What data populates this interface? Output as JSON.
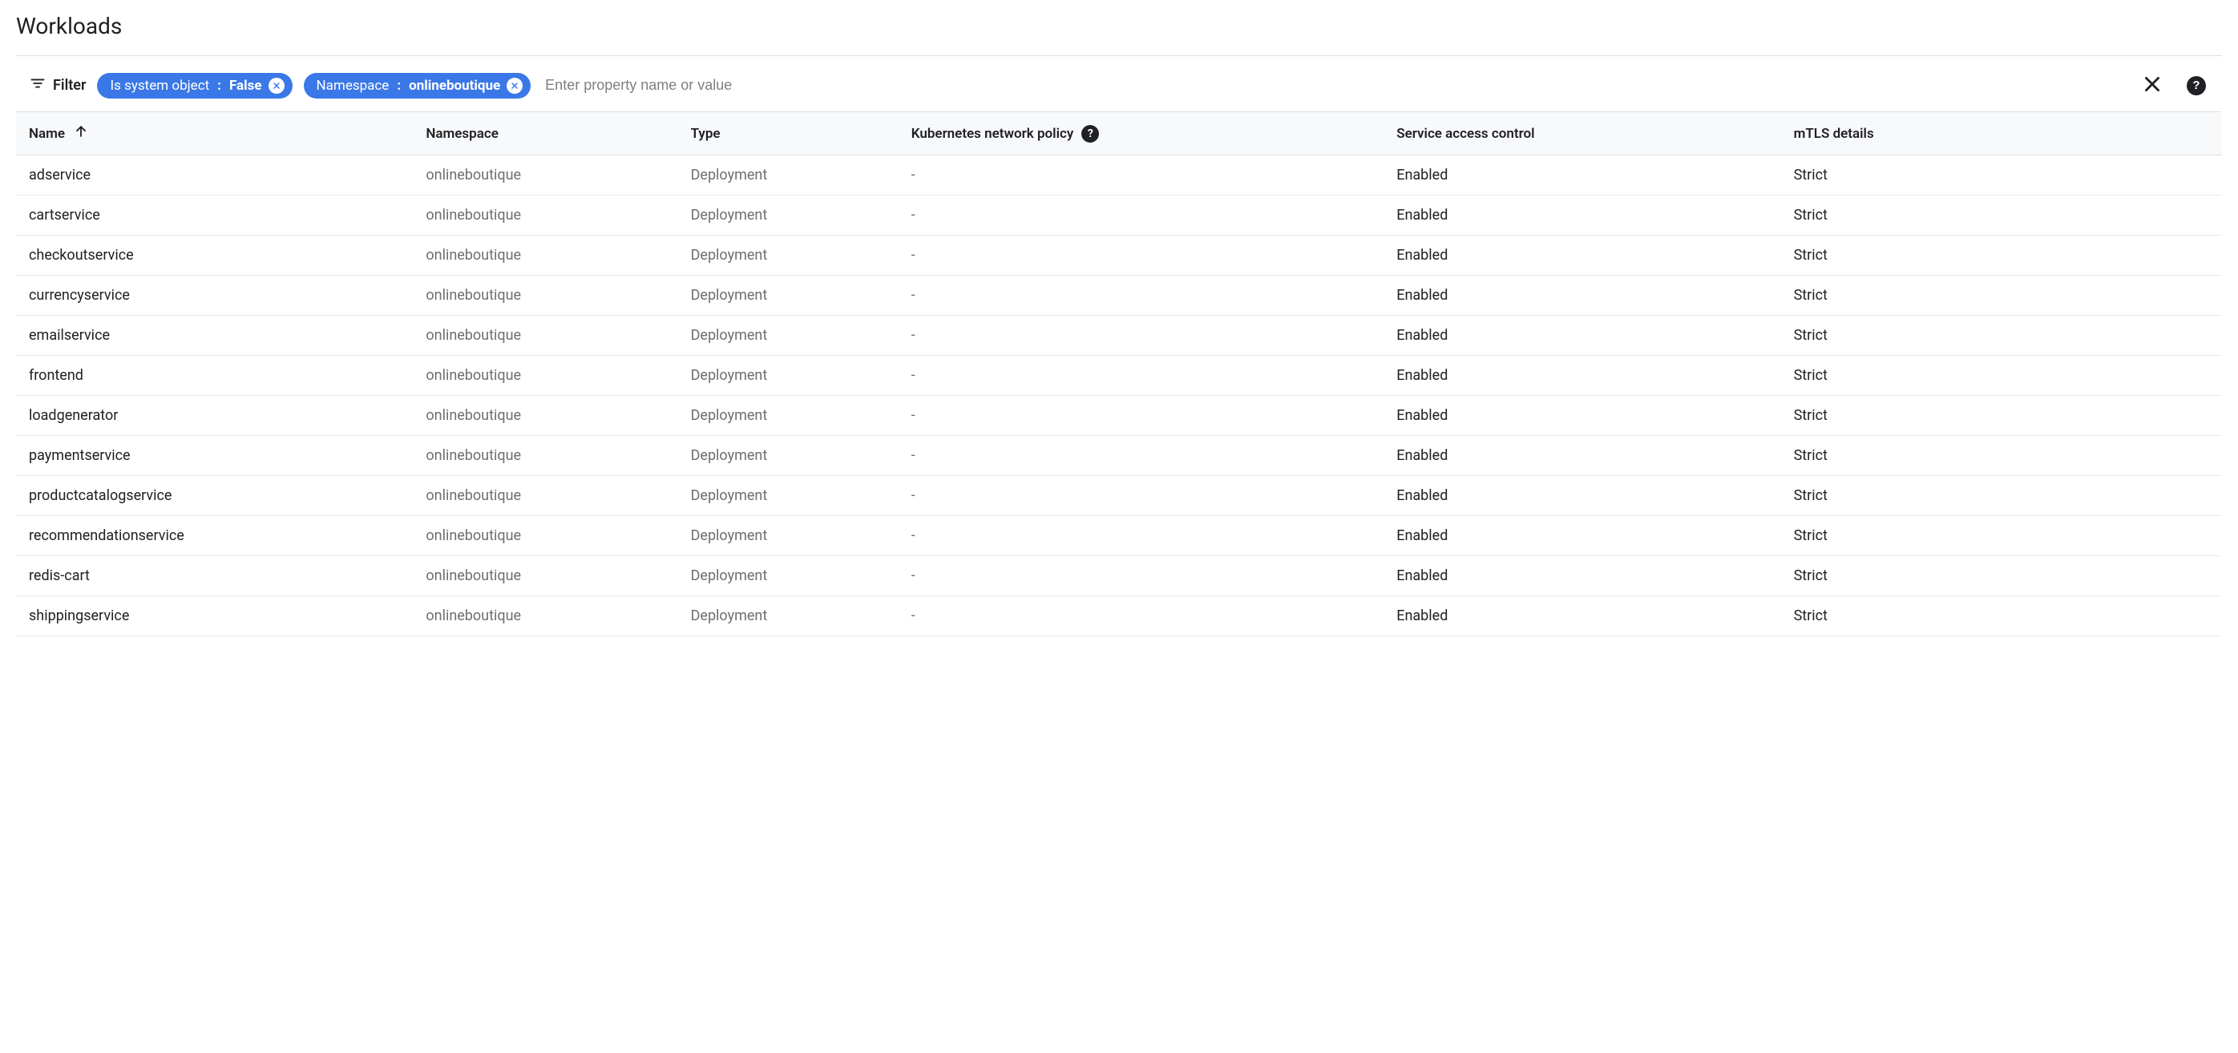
{
  "title": "Workloads",
  "filter": {
    "label": "Filter",
    "chips": [
      {
        "key": "Is system object",
        "value": "False"
      },
      {
        "key": "Namespace",
        "value": "onlineboutique"
      }
    ],
    "input_placeholder": "Enter property name or value"
  },
  "columns": {
    "name": "Name",
    "namespace": "Namespace",
    "type": "Type",
    "network_policy": "Kubernetes network policy",
    "service_access": "Service access control",
    "mtls": "mTLS details"
  },
  "rows": [
    {
      "name": "adservice",
      "namespace": "onlineboutique",
      "type": "Deployment",
      "network_policy": "-",
      "service_access": "Enabled",
      "mtls": "Strict"
    },
    {
      "name": "cartservice",
      "namespace": "onlineboutique",
      "type": "Deployment",
      "network_policy": "-",
      "service_access": "Enabled",
      "mtls": "Strict"
    },
    {
      "name": "checkoutservice",
      "namespace": "onlineboutique",
      "type": "Deployment",
      "network_policy": "-",
      "service_access": "Enabled",
      "mtls": "Strict"
    },
    {
      "name": "currencyservice",
      "namespace": "onlineboutique",
      "type": "Deployment",
      "network_policy": "-",
      "service_access": "Enabled",
      "mtls": "Strict"
    },
    {
      "name": "emailservice",
      "namespace": "onlineboutique",
      "type": "Deployment",
      "network_policy": "-",
      "service_access": "Enabled",
      "mtls": "Strict"
    },
    {
      "name": "frontend",
      "namespace": "onlineboutique",
      "type": "Deployment",
      "network_policy": "-",
      "service_access": "Enabled",
      "mtls": "Strict"
    },
    {
      "name": "loadgenerator",
      "namespace": "onlineboutique",
      "type": "Deployment",
      "network_policy": "-",
      "service_access": "Enabled",
      "mtls": "Strict"
    },
    {
      "name": "paymentservice",
      "namespace": "onlineboutique",
      "type": "Deployment",
      "network_policy": "-",
      "service_access": "Enabled",
      "mtls": "Strict"
    },
    {
      "name": "productcatalogservice",
      "namespace": "onlineboutique",
      "type": "Deployment",
      "network_policy": "-",
      "service_access": "Enabled",
      "mtls": "Strict"
    },
    {
      "name": "recommendationservice",
      "namespace": "onlineboutique",
      "type": "Deployment",
      "network_policy": "-",
      "service_access": "Enabled",
      "mtls": "Strict"
    },
    {
      "name": "redis-cart",
      "namespace": "onlineboutique",
      "type": "Deployment",
      "network_policy": "-",
      "service_access": "Enabled",
      "mtls": "Strict"
    },
    {
      "name": "shippingservice",
      "namespace": "onlineboutique",
      "type": "Deployment",
      "network_policy": "-",
      "service_access": "Enabled",
      "mtls": "Strict"
    }
  ]
}
